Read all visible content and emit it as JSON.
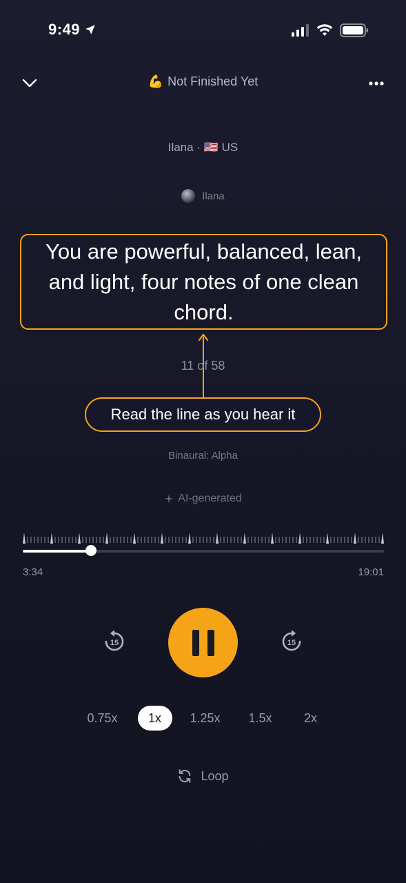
{
  "status_bar": {
    "time": "9:49"
  },
  "header": {
    "emoji": "💪",
    "title": "Not Finished Yet"
  },
  "voice": {
    "name": "Ilana",
    "flag": "🇺🇸",
    "country": "US",
    "separator": "·"
  },
  "author": {
    "name": "Ilana"
  },
  "affirmation": {
    "text": "You are powerful, balanced, lean, and light, four notes of one clean chord."
  },
  "counter": "11 of 58",
  "hint": "Read the line as you hear it",
  "binaural": "Binaural: Alpha",
  "ai_tag": "AI-generated",
  "player": {
    "elapsed": "3:34",
    "total": "19:01",
    "progress_fraction": 0.188,
    "skip_seconds": "15"
  },
  "speeds": {
    "options": [
      "0.75x",
      "1x",
      "1.25x",
      "1.5x",
      "2x"
    ],
    "selected": "1x"
  },
  "loop_label": "Loop",
  "colors": {
    "accent": "#f5a418",
    "background": "#171828"
  }
}
